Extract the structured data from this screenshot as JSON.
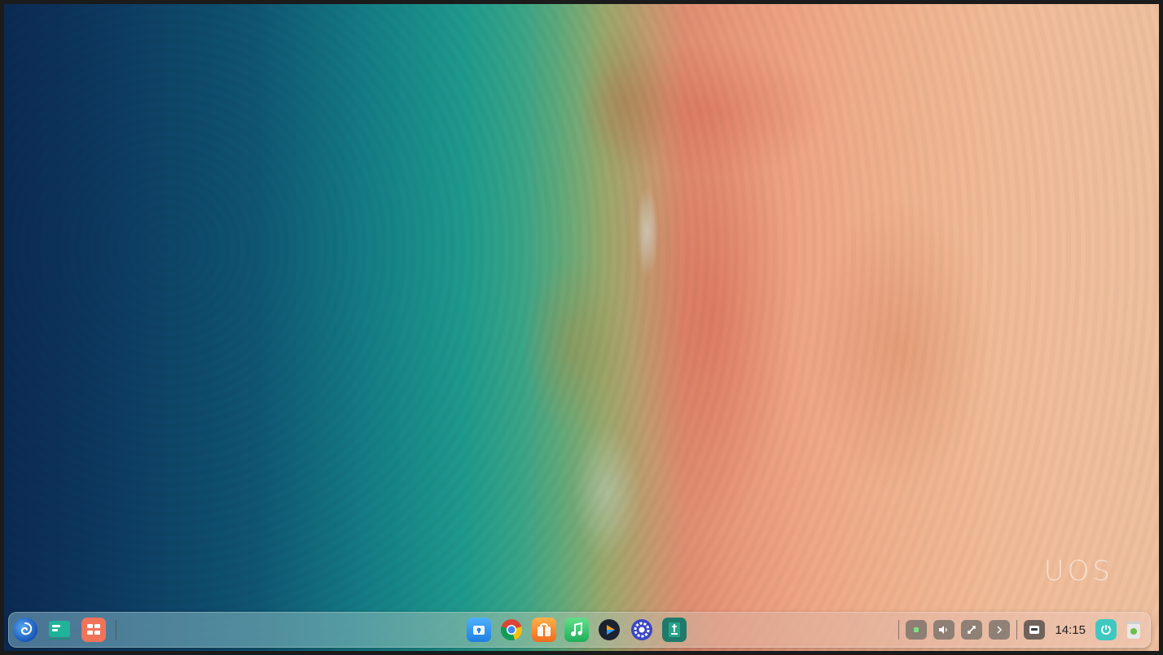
{
  "desktop": {
    "watermark": "UOS"
  },
  "dock": {
    "left_items": [
      {
        "name": "launcher-icon"
      },
      {
        "name": "multitasking-view-icon"
      },
      {
        "name": "show-desktop-icon"
      }
    ],
    "apps": [
      {
        "name": "file-manager-icon"
      },
      {
        "name": "chrome-icon"
      },
      {
        "name": "app-store-icon"
      },
      {
        "name": "music-icon"
      },
      {
        "name": "movie-player-icon"
      },
      {
        "name": "control-center-icon"
      },
      {
        "name": "document-viewer-icon"
      }
    ],
    "tray": {
      "clock": "14:15"
    }
  },
  "colors": {
    "accent": "#1e6fd1",
    "ocean": "#0d3b62",
    "sand": "#efb28f"
  }
}
